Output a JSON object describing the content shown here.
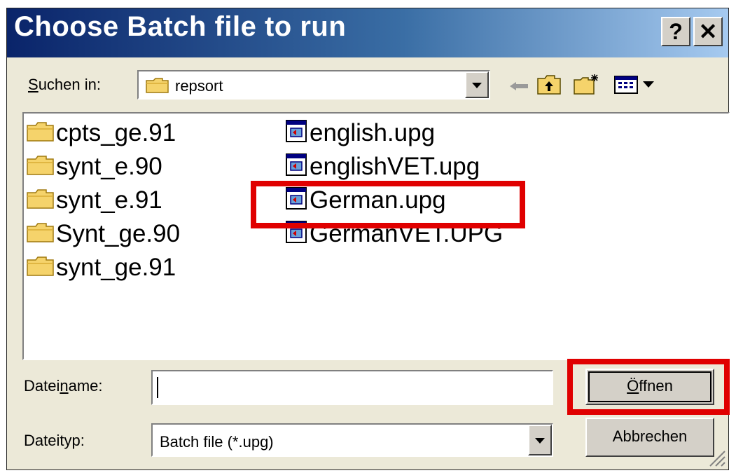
{
  "dialog": {
    "title": "Choose Batch file to run",
    "help_label": "?",
    "close_label": "✕"
  },
  "lookin": {
    "label_prefix": "S",
    "label_rest": "uchen in:",
    "folder": "repsort"
  },
  "toolbar": {
    "icons": [
      "back-arrow-icon",
      "up-folder-icon",
      "new-folder-icon",
      "view-menu-icon"
    ]
  },
  "files": {
    "column1": [
      {
        "name": "cpts_ge.91",
        "kind": "folder"
      },
      {
        "name": "synt_e.90",
        "kind": "folder"
      },
      {
        "name": "synt_e.91",
        "kind": "folder"
      },
      {
        "name": "Synt_ge.90",
        "kind": "folder"
      },
      {
        "name": "synt_ge.91",
        "kind": "folder"
      }
    ],
    "column2": [
      {
        "name": "english.upg",
        "kind": "file"
      },
      {
        "name": "englishVET.upg",
        "kind": "file"
      },
      {
        "name": "German.upg",
        "kind": "file"
      },
      {
        "name": "GermanVET.UPG",
        "kind": "file"
      }
    ]
  },
  "filename": {
    "label_a": "Datei",
    "label_u": "n",
    "label_b": "ame:",
    "value": ""
  },
  "filetype": {
    "label": "Dateityp:",
    "value": "Batch file (*.upg)"
  },
  "buttons": {
    "open_u": "Ö",
    "open_rest": "ffnen",
    "cancel": "Abbrechen"
  },
  "colors": {
    "highlight": "#e00000",
    "title_start": "#0a246a",
    "title_end": "#a6caf0",
    "face": "#ece9d8"
  }
}
